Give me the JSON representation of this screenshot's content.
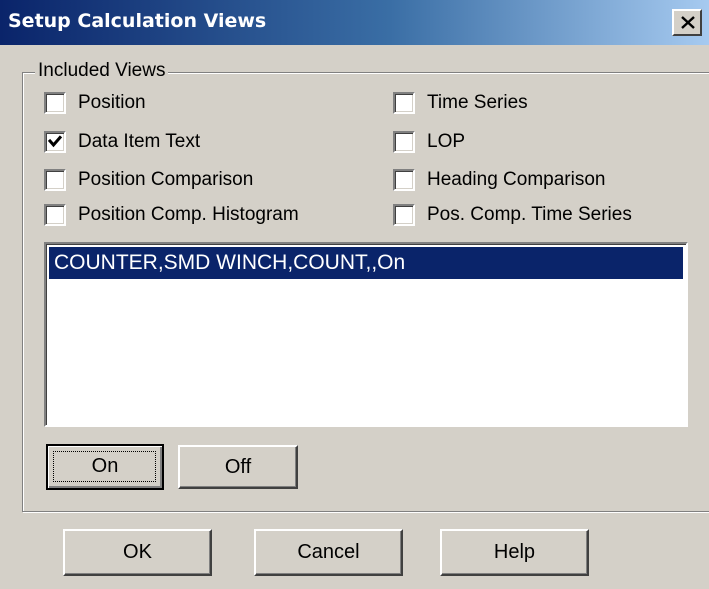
{
  "window": {
    "title": "Setup Calculation Views",
    "close_symbol": "close-icon"
  },
  "group": {
    "label": "Included Views",
    "checkboxes": [
      {
        "label": "Position",
        "checked": false
      },
      {
        "label": "Data Item Text",
        "checked": true
      },
      {
        "label": "Position Comparison",
        "checked": false
      },
      {
        "label": "Position Comp. Histogram",
        "checked": false
      },
      {
        "label": "Time Series",
        "checked": false
      },
      {
        "label": "LOP",
        "checked": false
      },
      {
        "label": "Heading Comparison",
        "checked": false
      },
      {
        "label": "Pos. Comp. Time Series",
        "checked": false
      }
    ],
    "list": {
      "items": [
        {
          "text": "COUNTER,SMD WINCH,COUNT,,On",
          "selected": true
        }
      ]
    },
    "on_label": "On",
    "off_label": "Off"
  },
  "footer": {
    "ok_label": "OK",
    "cancel_label": "Cancel",
    "help_label": "Help"
  },
  "colors": {
    "face": "#d4d0c8",
    "title_start": "#0a246a",
    "title_end": "#a6caf0",
    "selection": "#0a246a"
  }
}
